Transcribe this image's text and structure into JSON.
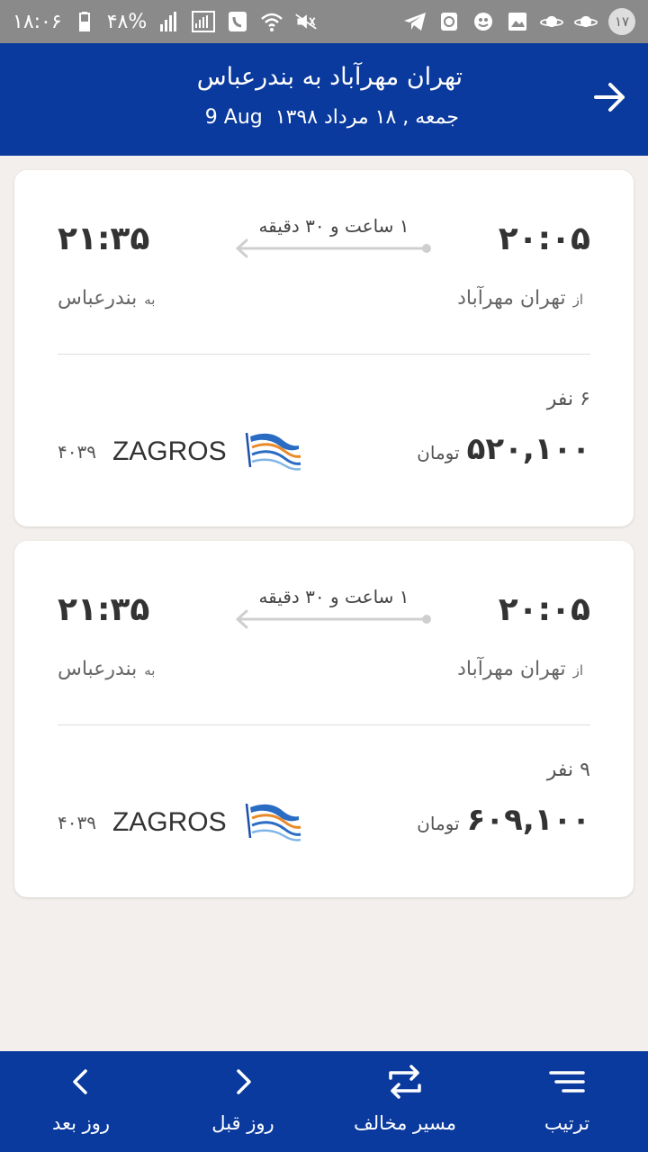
{
  "status_bar": {
    "time": "۱۸:۰۶",
    "battery": "۴۸%",
    "notification_count": "۱۷"
  },
  "header": {
    "title": "تهران مهرآباد به بندرعباس",
    "date_fa": "جمعه , ۱۸ مرداد ۱۳۹۸",
    "date_en": "9 Aug"
  },
  "flights": [
    {
      "departure_time": "۲۰:۰۵",
      "arrival_time": "۲۱:۳۵",
      "duration": "۱ ساعت و ۳۰ دقیقه",
      "from_prefix": "از",
      "from": "تهران مهرآباد",
      "to_prefix": "به",
      "to": "بندرعباس",
      "passengers": "۶ نفر",
      "price": "۵۲۰,۱۰۰",
      "currency": "تومان",
      "airline": "ZAGROS",
      "flight_number": "۴۰۳۹"
    },
    {
      "departure_time": "۲۰:۰۵",
      "arrival_time": "۲۱:۳۵",
      "duration": "۱ ساعت و ۳۰ دقیقه",
      "from_prefix": "از",
      "from": "تهران مهرآباد",
      "to_prefix": "به",
      "to": "بندرعباس",
      "passengers": "۹ نفر",
      "price": "۶۰۹,۱۰۰",
      "currency": "تومان",
      "airline": "ZAGROS",
      "flight_number": "۴۰۳۹"
    }
  ],
  "bottom_nav": {
    "sort": "ترتیب",
    "reverse": "مسیر مخالف",
    "prev_day": "روز قبل",
    "next_day": "روز بعد"
  },
  "colors": {
    "primary": "#0a3a9e",
    "background": "#f3efec",
    "card": "#ffffff"
  }
}
